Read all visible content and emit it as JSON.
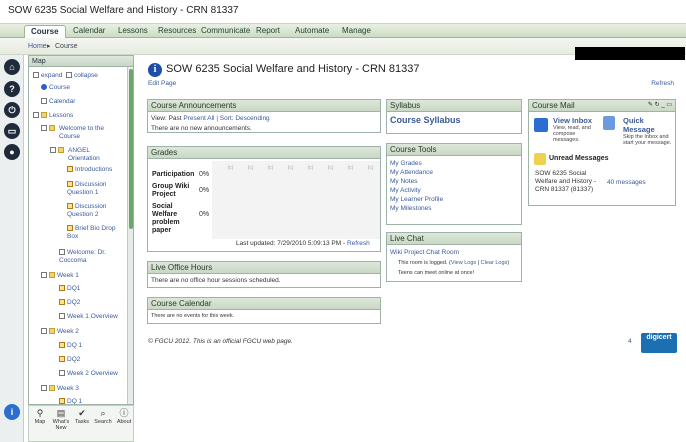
{
  "app": {
    "title": "SOW 6235 Social Welfare and History - CRN 81337"
  },
  "nav": {
    "tabs": [
      {
        "label": "Course",
        "active": true
      },
      {
        "label": "Calendar"
      },
      {
        "label": "Lessons"
      },
      {
        "label": "Resources"
      },
      {
        "label": "Communicate"
      },
      {
        "label": "Report"
      },
      {
        "label": "Automate"
      },
      {
        "label": "Manage"
      }
    ]
  },
  "breadcrumb": {
    "home": "Home",
    "sep": "▸",
    "current": "Course"
  },
  "map": {
    "title": "Map",
    "expand": "expand",
    "collapse": "collapse",
    "items": [
      {
        "label": "Course",
        "icon": "info-icon"
      },
      {
        "label": "Calendar",
        "icon": "calendar-icon"
      },
      {
        "label": "Lessons",
        "icon": "minus-icon"
      },
      {
        "label": "Welcome to the Course",
        "icon": "folder-icon"
      },
      {
        "label": "ANGEL Orientation",
        "icon": "folder-icon"
      },
      {
        "label": "Introductions",
        "icon": "edit-icon"
      },
      {
        "label": "Discussion Question 1",
        "icon": "edit-icon"
      },
      {
        "label": "Discussion Question 2",
        "icon": "edit-icon"
      },
      {
        "label": "Brief Bio Drop Box",
        "icon": "edit-icon"
      },
      {
        "label": "Welcome: Dr. Coccoma",
        "icon": "doc-icon"
      },
      {
        "label": "Week 1",
        "icon": "folder-icon"
      },
      {
        "label": "DQ1",
        "icon": "edit-icon"
      },
      {
        "label": "DQ2",
        "icon": "edit-icon"
      },
      {
        "label": "Week 1 Overview",
        "icon": "doc-icon"
      },
      {
        "label": "Week 2",
        "icon": "folder-icon"
      },
      {
        "label": "DQ 1",
        "icon": "edit-icon"
      },
      {
        "label": "DQ2",
        "icon": "edit-icon"
      },
      {
        "label": "Week 2 Overview",
        "icon": "doc-icon"
      },
      {
        "label": "Week 3",
        "icon": "folder-icon"
      },
      {
        "label": "DQ 1",
        "icon": "edit-icon"
      }
    ]
  },
  "tools": [
    {
      "label": "Map",
      "icon": "map-icon"
    },
    {
      "label": "What's New",
      "icon": "whats-new-icon"
    },
    {
      "label": "Tasks",
      "icon": "check-icon"
    },
    {
      "label": "Search",
      "icon": "search-icon"
    },
    {
      "label": "About",
      "icon": "info-icon"
    }
  ],
  "page": {
    "title": "SOW 6235 Social Welfare and History - CRN 81337",
    "edit": "Edit Page",
    "refresh": "Refresh"
  },
  "announcements": {
    "title": "Course Announcements",
    "filters": [
      "View: Past",
      "Present",
      "All",
      "| Sort: Descending"
    ],
    "empty": "There are no new announcements."
  },
  "grades": {
    "title": "Grades",
    "rows": [
      {
        "label": "Participation",
        "value": "0%"
      },
      {
        "label": "Group Wiki Project",
        "value": "0%"
      },
      {
        "label": "Social Welfare problem paper",
        "value": "0%"
      }
    ],
    "updated": "Last updated: 7/29/2010 5:09:13 PM - ",
    "refresh": "Refresh"
  },
  "office_hours": {
    "title": "Live Office Hours",
    "text": "There are no office hour sessions scheduled."
  },
  "calendar": {
    "title": "Course Calendar",
    "text": "There are no events for this week."
  },
  "syllabus": {
    "title": "Syllabus",
    "link": "Course Syllabus"
  },
  "course_tools": {
    "title": "Course Tools",
    "items": [
      "My Grades",
      "My Attendance",
      "My Notes",
      "My Activity",
      "My Learner Profile",
      "My Milestones"
    ]
  },
  "live_chat": {
    "title": "Live Chat",
    "room": "Wiki Project Chat Room",
    "logged": "This room is logged. (",
    "view_logs": "View Logs",
    "sep": " | ",
    "clear_logs": "Clear Logs",
    "logged_end": ")",
    "online": "Teens can meet online at once!"
  },
  "mail": {
    "title": "Course Mail",
    "view_inbox": "View Inbox",
    "view_desc": "View, read, and compose messages.",
    "quick": "Quick Message",
    "quick_desc": "Skip the Inbox and start your message.",
    "unread_title": "Unread Messages",
    "course": "SOW 6235 Social Welfare and History - CRN 81337 (81337)",
    "count": "40 messages"
  },
  "footer": {
    "text": "© FGCU 2012. This is an official FGCU web page.",
    "number": "4",
    "cert": "digicert"
  },
  "colors": {
    "accent": "#1e4fa8",
    "header_green": "#c9d8c4",
    "link": "#3a5a9a"
  }
}
